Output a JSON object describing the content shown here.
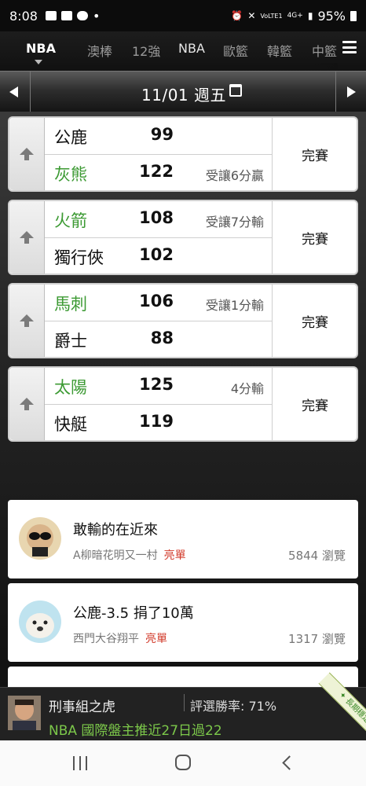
{
  "status_bar": {
    "time": "8:08",
    "dot": "•",
    "battery": "95%",
    "network": "4G+",
    "volte": "VoLTE1"
  },
  "tabs": {
    "items": [
      "NBA",
      "澳棒",
      "12強",
      "NBA",
      "歐籃",
      "韓籃",
      "中籃"
    ],
    "active_index": 0
  },
  "date_bar": {
    "date": "11/01 週五"
  },
  "games": [
    {
      "top": {
        "team": "公鹿",
        "score": "99",
        "note": "",
        "winner": false
      },
      "bottom": {
        "team": "灰熊",
        "score": "122",
        "note": "受讓6分贏",
        "winner": true
      },
      "status": "完賽"
    },
    {
      "top": {
        "team": "火箭",
        "score": "108",
        "note": "受讓7分輸",
        "winner": true
      },
      "bottom": {
        "team": "獨行俠",
        "score": "102",
        "note": "",
        "winner": false
      },
      "status": "完賽"
    },
    {
      "top": {
        "team": "馬刺",
        "score": "106",
        "note": "受讓1分輸",
        "winner": true
      },
      "bottom": {
        "team": "爵士",
        "score": "88",
        "note": "",
        "winner": false
      },
      "status": "完賽"
    },
    {
      "top": {
        "team": "太陽",
        "score": "125",
        "note": "4分輸",
        "winner": true
      },
      "bottom": {
        "team": "快艇",
        "score": "119",
        "note": "",
        "winner": false
      },
      "status": "完賽"
    }
  ],
  "articles": [
    {
      "title": "敢輸的在近來",
      "author": "A柳暗花明又一村",
      "badge": "亮單",
      "views": "5844 瀏覽"
    },
    {
      "title": "公鹿-3.5 捐了10萬",
      "author": "西門大谷翔平",
      "badge": "亮單",
      "views": "1317 瀏覽"
    }
  ],
  "promo": {
    "name": "刑事組之虎",
    "win_rate": "評選勝率: 71%",
    "pick": "NBA 國際盤主推近27日過22",
    "ribbon": "✦ 長期穩定 ✦"
  },
  "colors": {
    "winner_green": "#3c9a33",
    "badge_red": "#d23a2a",
    "promo_green": "#7cc84a"
  }
}
